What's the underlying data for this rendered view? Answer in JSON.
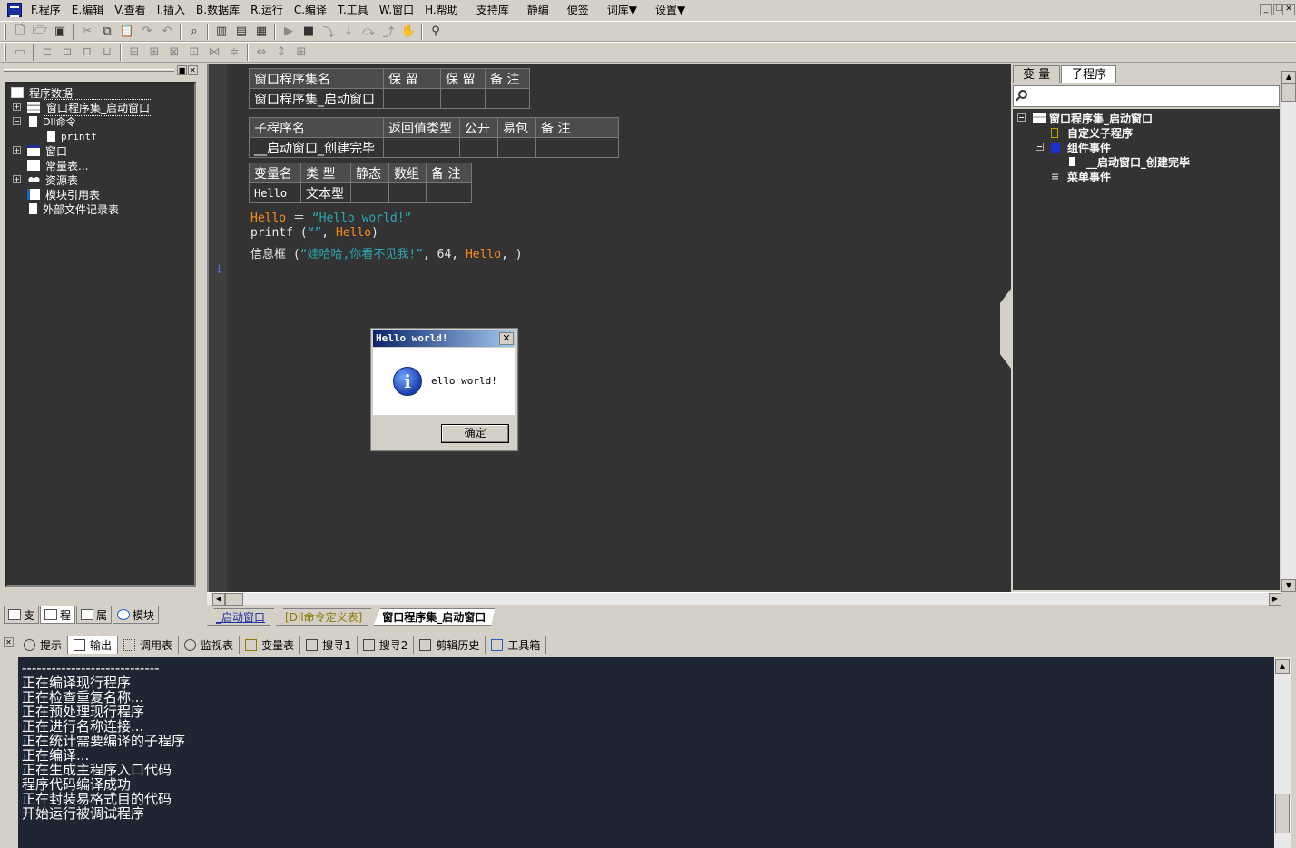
{
  "menubar": {
    "items": [
      "F.程序",
      "E.编辑",
      "V.查看",
      "I.插入",
      "B.数据库",
      "R.运行",
      "C.编译",
      "T.工具",
      "W.窗口",
      "H.帮助",
      "支持库",
      "静编",
      "便签",
      "词库▼",
      "设置▼"
    ]
  },
  "left_panel": {
    "tree": [
      {
        "label": "程序数据",
        "icon": "program-data-icon"
      },
      {
        "label": "窗口程序集_启动窗口",
        "icon": "assembly-icon",
        "selected": true
      },
      {
        "label": "Dll命令",
        "icon": "dll-icon"
      },
      {
        "label": "printf",
        "icon": "doc-icon"
      },
      {
        "label": "窗口",
        "icon": "window-icon"
      },
      {
        "label": "常量表...",
        "icon": "constant-icon"
      },
      {
        "label": "资源表",
        "icon": "resource-icon"
      },
      {
        "label": "模块引用表",
        "icon": "module-icon"
      },
      {
        "label": "外部文件记录表",
        "icon": "file-icon"
      }
    ],
    "tabs": [
      "支",
      "程",
      "属",
      "模块"
    ]
  },
  "editor": {
    "assembly_table": {
      "headers": [
        "窗口程序集名",
        "保 留",
        "保 留",
        "备 注"
      ],
      "row": [
        "窗口程序集_启动窗口",
        "",
        "",
        ""
      ]
    },
    "sub_table": {
      "headers": [
        "子程序名",
        "返回值类型",
        "公开",
        "易包",
        "备 注"
      ],
      "row": [
        "__启动窗口_创建完毕",
        "",
        "",
        "",
        ""
      ]
    },
    "var_table": {
      "headers": [
        "变量名",
        "类 型",
        "静态",
        "数组",
        "备 注"
      ],
      "row": [
        "Hello",
        "文本型",
        "",
        "",
        ""
      ]
    },
    "code": {
      "line1": {
        "var": "Hello",
        "op": " ＝ ",
        "str": "“Hello world!”"
      },
      "line2": {
        "fn": "printf",
        "open": " (",
        "str": "“”",
        "sep": ", ",
        "var": "Hello",
        "close": ")"
      },
      "line3": {
        "fn": "信息框",
        "open": " (",
        "str": "“娃哈哈,你看不见我!”",
        "num": ", 64, ",
        "var": "Hello",
        "close": ", )"
      }
    },
    "tabs": [
      "_启动窗口",
      "[Dll命令定义表]",
      "窗口程序集_启动窗口"
    ]
  },
  "right_panel": {
    "tabs": [
      "变 量",
      "子程序"
    ],
    "tree": [
      {
        "label": "窗口程序集_启动窗口"
      },
      {
        "label": "自定义子程序"
      },
      {
        "label": "组件事件"
      },
      {
        "label": "__启动窗口_创建完毕"
      },
      {
        "label": "菜单事件"
      }
    ]
  },
  "bottom_panel": {
    "tabs": [
      "提示",
      "输出",
      "调用表",
      "监视表",
      "变量表",
      "搜寻1",
      "搜寻2",
      "剪辑历史",
      "工具箱"
    ],
    "output_lines": [
      "----------------------------",
      "正在编译现行程序",
      "正在检查重复名称...",
      "正在预处理现行程序",
      "正在进行名称连接...",
      "正在统计需要编译的子程序",
      "正在编译...",
      "正在生成主程序入口代码",
      "程序代码编译成功",
      "正在封装易格式目的代码",
      "开始运行被调试程序"
    ]
  },
  "message_box": {
    "title": "Hello world!",
    "message": "ello world!",
    "ok_label": "确定",
    "close_label": "✕",
    "info_glyph": "i"
  },
  "colors": {
    "editor_bg": "#333333",
    "keyword_orange": "#ff8c1a",
    "string_cyan": "#2fa6b3",
    "var_pink": "#ff6080",
    "output_bg": "#1f2633"
  }
}
